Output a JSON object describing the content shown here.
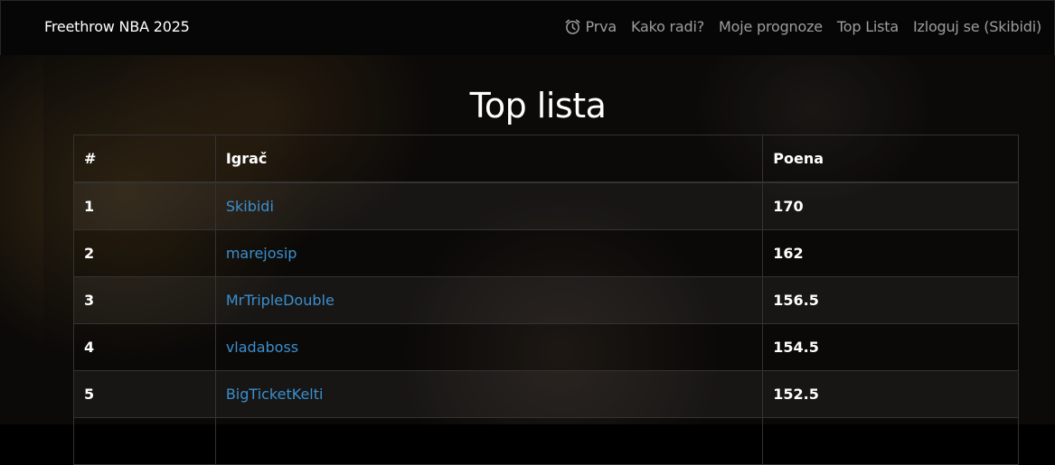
{
  "navbar": {
    "brand": "Freethrow NBA 2025",
    "links": [
      {
        "label": "Prva",
        "icon": "alarm-clock-icon"
      },
      {
        "label": "Kako radi?"
      },
      {
        "label": "Moje prognoze"
      },
      {
        "label": "Top Lista"
      },
      {
        "label": "Izloguj se (Skibidi)"
      }
    ]
  },
  "page": {
    "title": "Top lista"
  },
  "leaderboard": {
    "headers": {
      "rank": "#",
      "player": "Igrač",
      "points": "Poena"
    },
    "rows": [
      {
        "rank": "1",
        "player": "Skibidi",
        "points": "170"
      },
      {
        "rank": "2",
        "player": "marejosip",
        "points": "162"
      },
      {
        "rank": "3",
        "player": "MrTripleDouble",
        "points": "156.5"
      },
      {
        "rank": "4",
        "player": "vladaboss",
        "points": "154.5"
      },
      {
        "rank": "5",
        "player": "BigTicketKelti",
        "points": "152.5"
      },
      {
        "rank": "",
        "player": "",
        "points": ""
      }
    ]
  },
  "colors": {
    "navbar_bg": "#060606",
    "link": "#3a8fcf",
    "nav_text": "#9d9d9d"
  }
}
